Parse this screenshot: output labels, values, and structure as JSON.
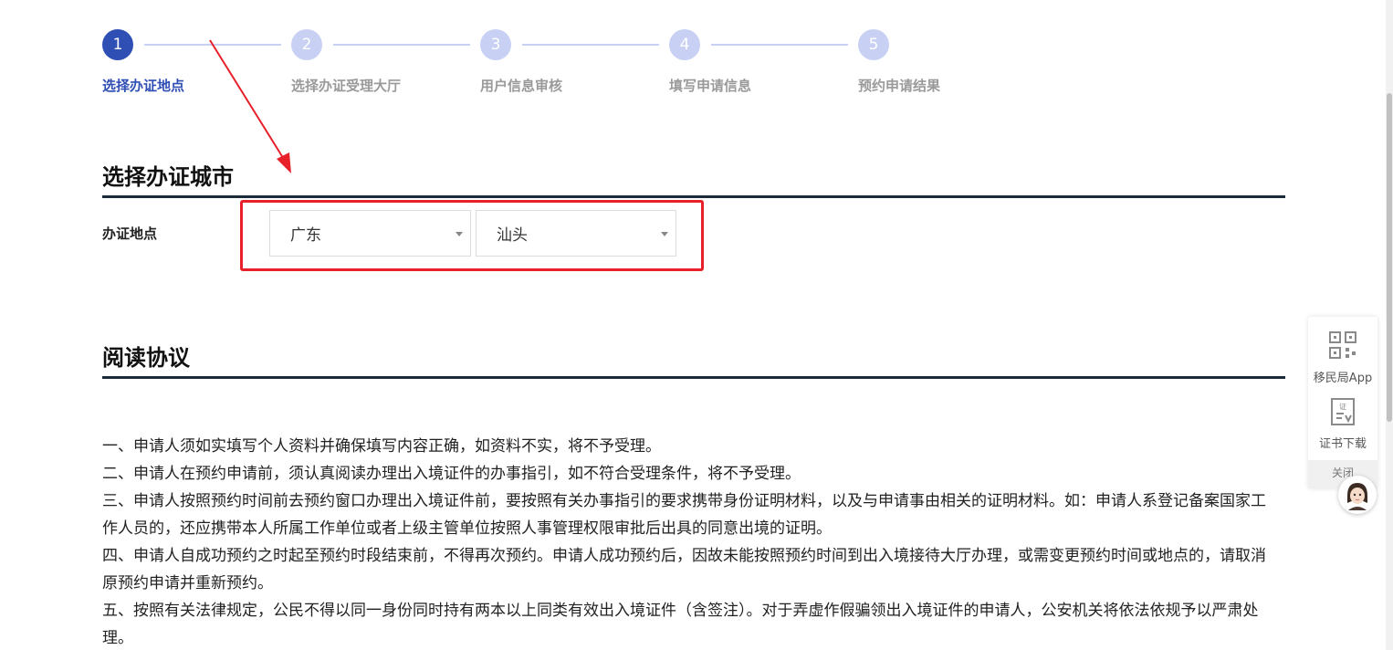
{
  "steps": [
    {
      "number": "1",
      "label": "选择办证地点",
      "active": true
    },
    {
      "number": "2",
      "label": "选择办证受理大厅",
      "active": false
    },
    {
      "number": "3",
      "label": "用户信息审核",
      "active": false
    },
    {
      "number": "4",
      "label": "填写申请信息",
      "active": false
    },
    {
      "number": "5",
      "label": "预约申请结果",
      "active": false
    }
  ],
  "city_section": {
    "title": "选择办证城市",
    "field_label": "办证地点",
    "province_value": "广东",
    "city_value": "汕头"
  },
  "agreement_section": {
    "title": "阅读协议",
    "paragraphs": [
      "一、申请人须如实填写个人资料并确保填写内容正确，如资料不实，将不予受理。",
      "二、申请人在预约申请前，须认真阅读办理出入境证件的办事指引，如不符合受理条件，将不予受理。",
      "三、申请人按照预约时间前去预约窗口办理出入境证件前，要按照有关办事指引的要求携带身份证明材料，以及与申请事由相关的证明材料。如：申请人系登记备案国家工作人员的，还应携带本人所属工作单位或者上级主管单位按照人事管理权限审批后出具的同意出境的证明。",
      "四、申请人自成功预约之时起至预约时段结束前，不得再次预约。申请人成功预约后，因故未能按照预约时间到出入境接待大厅办理，或需变更预约时间或地点的，请取消原预约申请并重新预约。",
      "五、按照有关法律规定，公民不得以同一身份同时持有两本以上同类有效出入境证件（含签注）。对于弄虚作假骗领出入境证件的申请人，公安机关将依法依规予以严肃处理。"
    ]
  },
  "side_panel": {
    "app_label": "移民局App",
    "cert_label": "证书下载",
    "close_label": "关闭"
  },
  "colors": {
    "accent": "#2f4fb5",
    "step_inactive": "#c8d1f4",
    "annotation_red": "#e8202a"
  },
  "icons": [
    "qr-code-icon",
    "certificate-icon",
    "assistant-avatar-icon",
    "dropdown-caret-icon"
  ]
}
